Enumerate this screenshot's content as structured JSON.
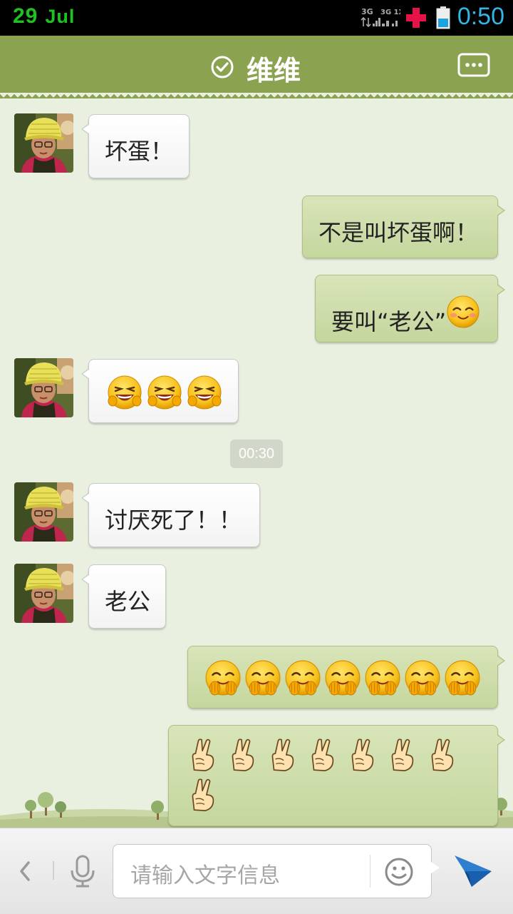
{
  "status_bar": {
    "date_day": "29",
    "date_month": "Jul",
    "time": "0:50",
    "icons": [
      "signal-3g-icon",
      "signal-3g-1x-icon",
      "medical-cross-icon",
      "battery-icon"
    ]
  },
  "header": {
    "title": "维维",
    "verified_icon": "check-circle-icon",
    "menu_icon": "more-dots-icon"
  },
  "messages": [
    {
      "side": "in",
      "text": "坏蛋！"
    },
    {
      "side": "out",
      "text": "不是叫坏蛋啊！"
    },
    {
      "side": "out",
      "text": "要叫“老公”",
      "emoji": [
        "blush-emoji"
      ]
    },
    {
      "side": "in",
      "text": "",
      "emoji": [
        "laugh-cry-emoji",
        "laugh-cry-emoji",
        "laugh-cry-emoji"
      ]
    },
    {
      "side": "in",
      "text": "讨厌死了！！"
    },
    {
      "side": "in",
      "text": "老公"
    },
    {
      "side": "out",
      "text": "",
      "emoji": [
        "giggle-emoji",
        "giggle-emoji",
        "giggle-emoji",
        "giggle-emoji",
        "giggle-emoji",
        "giggle-emoji",
        "giggle-emoji"
      ]
    },
    {
      "side": "out",
      "text": "",
      "emoji": [
        "victory-hand-emoji",
        "victory-hand-emoji",
        "victory-hand-emoji",
        "victory-hand-emoji",
        "victory-hand-emoji",
        "victory-hand-emoji",
        "victory-hand-emoji",
        "victory-hand-emoji"
      ]
    }
  ],
  "timestamp": "00:30",
  "input_bar": {
    "placeholder": "请输入文字信息",
    "icons": [
      "back-chevron-icon",
      "microphone-icon",
      "smiley-icon",
      "send-icon"
    ]
  },
  "colors": {
    "title_bar": "#8ba251",
    "chat_background": "#e9f0df",
    "outgoing_bubble": "#c9d9a3",
    "incoming_bubble": "#ffffff",
    "clock": "#33b5e5",
    "date": "#1fc21f"
  }
}
